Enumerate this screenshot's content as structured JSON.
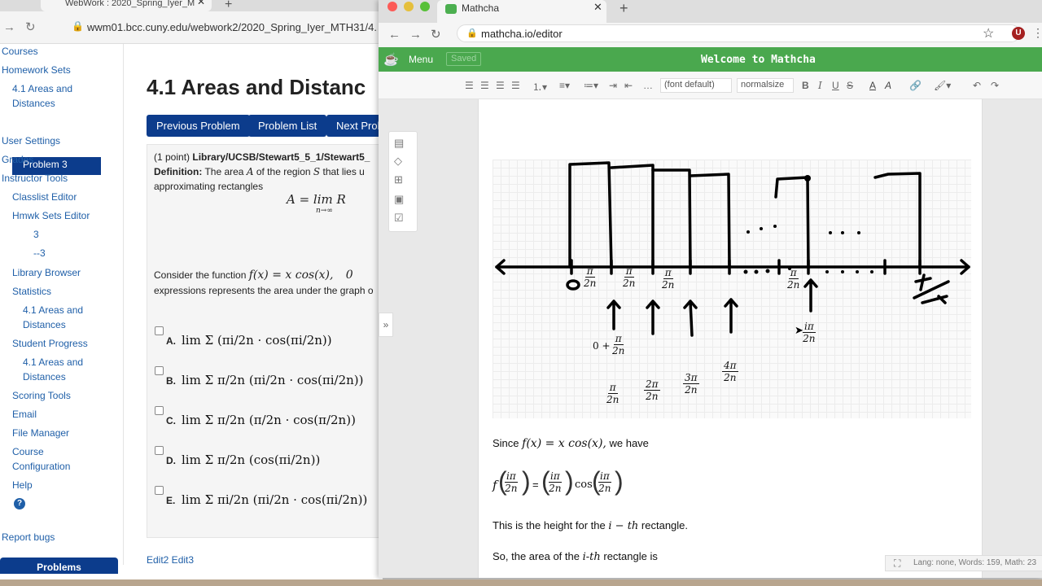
{
  "webwork": {
    "tab_title": "WebWork : 2020_Spring_Iyer_M",
    "url": "wwm01.bcc.cuny.edu/webwork2/2020_Spring_Iyer_MTH31/4.",
    "sidebar": {
      "courses": "Courses",
      "homework_sets": "Homework Sets",
      "set_name_1": "4.1 Areas and",
      "set_name_2": "Distances",
      "problem_3": "Problem 3",
      "user_settings": "User Settings",
      "grades": "Grades",
      "instructor_tools": "Instructor Tools",
      "classlist_editor": "Classlist Editor",
      "hmwk_sets_editor": "Hmwk Sets Editor",
      "sub_3": "3",
      "sub_minus3": "--3",
      "library_browser": "Library Browser",
      "statistics": "Statistics",
      "stat_set_1": "4.1 Areas and",
      "stat_set_2": "Distances",
      "student_progress": "Student Progress",
      "sp_set_1": "4.1 Areas and",
      "sp_set_2": "Distances",
      "scoring_tools": "Scoring Tools",
      "email": "Email",
      "file_manager": "File Manager",
      "course_config_1": "Course",
      "course_config_2": "Configuration",
      "help": "Help",
      "report_bugs": "Report bugs",
      "problems_button": "Problems"
    },
    "title": "4.1 Areas and Distanc",
    "buttons": {
      "previous": "Previous Problem",
      "list": "Problem List",
      "next": "Next Prob"
    },
    "problem": {
      "points": "(1 point)",
      "library_path": "Library/UCSB/Stewart5_5_1/Stewart5_",
      "definition_label": "Definition:",
      "definition_text": "The area",
      "of_region": "of the region",
      "that_lies": "that lies u",
      "approximating": "approximating rectangles",
      "limit_formula": "A = lim R",
      "consider": "Consider the function",
      "function_expr": "f(x) = x cos(x),",
      "function_tail": "0",
      "expressions": "expressions represents the area under the graph o"
    },
    "choices": [
      {
        "letter": "A.",
        "expr": "lim Σ (πi/2n · cos(πi/2n))"
      },
      {
        "letter": "B.",
        "expr": "lim Σ π/2n (πi/2n · cos(πi/2n))"
      },
      {
        "letter": "C.",
        "expr": "lim Σ π/2n (π/2n · cos(π/2n))"
      },
      {
        "letter": "D.",
        "expr": "lim Σ π/2n (cos(πi/2n))"
      },
      {
        "letter": "E.",
        "expr": "lim Σ πi/2n (πi/2n · cos(πi/2n))"
      }
    ],
    "edit_links": "Edit2 Edit3"
  },
  "mathcha": {
    "tab_title": "Mathcha",
    "url": "mathcha.io/editor",
    "menu": "Menu",
    "saved": "Saved",
    "welcome": "Welcome to Mathcha",
    "font_select": "(font default)",
    "size_select": "normalsize",
    "avatar_letter": "U",
    "drawing": {
      "frac_num_pi": "π",
      "frac_num_ipi": "iπ",
      "frac_num_2pi": "2π",
      "frac_num_3pi": "3π",
      "frac_num_4pi": "4π",
      "frac_den": "2n",
      "zero_plus": "0 +"
    },
    "text": {
      "since": "Since",
      "since_expr": "f(x)  = x cos(x),",
      "we_have": "we have",
      "eq_lhs": "f",
      "eq_cos": "cos",
      "height_line_a": "This is the height for the",
      "height_line_b": "i − th",
      "height_line_c": "rectangle.",
      "area_line_a": "So, the area of the",
      "area_line_b": "i-th",
      "area_line_c": "rectangle is"
    },
    "status": "Lang: none, Words: 159, Math: 23"
  },
  "colors": {
    "webwork_blue": "#0c3c8c",
    "link_blue": "#1f5fa8",
    "mathcha_green": "#4aa84e"
  }
}
